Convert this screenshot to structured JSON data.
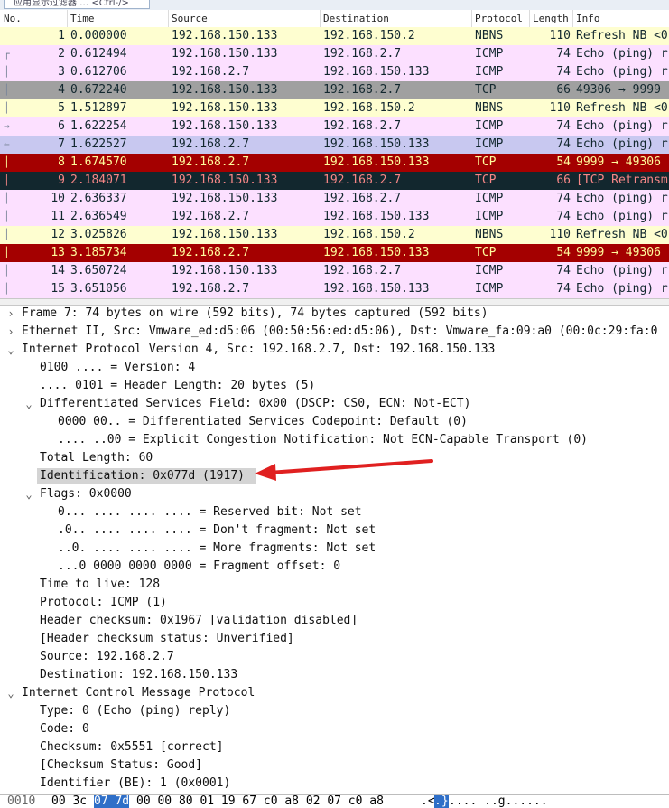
{
  "filter": {
    "text": "应用显示过滤器 … <Ctrl-/>"
  },
  "columns": [
    "No.",
    "Time",
    "Source",
    "Destination",
    "Protocol",
    "Length",
    "Info"
  ],
  "packets": [
    {
      "no": "1",
      "time": "0.000000",
      "src": "192.168.150.133",
      "dst": "192.168.150.2",
      "proto": "NBNS",
      "len": "110",
      "info": "Refresh NB <0",
      "bg": "#fefed0",
      "fg": "#12272e",
      "rel": ""
    },
    {
      "no": "2",
      "time": "0.612494",
      "src": "192.168.150.133",
      "dst": "192.168.2.7",
      "proto": "ICMP",
      "len": "74",
      "info": "Echo (ping) r",
      "bg": "#fce0ff",
      "fg": "#12272e",
      "rel": "┌"
    },
    {
      "no": "3",
      "time": "0.612706",
      "src": "192.168.2.7",
      "dst": "192.168.150.133",
      "proto": "ICMP",
      "len": "74",
      "info": "Echo (ping) r",
      "bg": "#fce0ff",
      "fg": "#12272e",
      "rel": "│"
    },
    {
      "no": "4",
      "time": "0.672240",
      "src": "192.168.150.133",
      "dst": "192.168.2.7",
      "proto": "TCP",
      "len": "66",
      "info": "49306 → 9999",
      "bg": "#a0a0a0",
      "fg": "#12272e",
      "rel": "│"
    },
    {
      "no": "5",
      "time": "1.512897",
      "src": "192.168.150.133",
      "dst": "192.168.150.2",
      "proto": "NBNS",
      "len": "110",
      "info": "Refresh NB <0",
      "bg": "#fefed0",
      "fg": "#12272e",
      "rel": "│"
    },
    {
      "no": "6",
      "time": "1.622254",
      "src": "192.168.150.133",
      "dst": "192.168.2.7",
      "proto": "ICMP",
      "len": "74",
      "info": "Echo (ping) r",
      "bg": "#fce0ff",
      "fg": "#12272e",
      "rel": "→"
    },
    {
      "no": "7",
      "time": "1.622527",
      "src": "192.168.2.7",
      "dst": "192.168.150.133",
      "proto": "ICMP",
      "len": "74",
      "info": "Echo (ping) r",
      "bg": "#c8c8f0",
      "fg": "#12272e",
      "rel": "←"
    },
    {
      "no": "8",
      "time": "1.674570",
      "src": "192.168.2.7",
      "dst": "192.168.150.133",
      "proto": "TCP",
      "len": "54",
      "info": "9999 → 49306",
      "bg": "#a40000",
      "fg": "#fffc9c",
      "rel": "│"
    },
    {
      "no": "9",
      "time": "2.184071",
      "src": "192.168.150.133",
      "dst": "192.168.2.7",
      "proto": "TCP",
      "len": "66",
      "info": "[TCP Retransm",
      "bg": "#12272e",
      "fg": "#f78787",
      "rel": "│"
    },
    {
      "no": "10",
      "time": "2.636337",
      "src": "192.168.150.133",
      "dst": "192.168.2.7",
      "proto": "ICMP",
      "len": "74",
      "info": "Echo (ping) r",
      "bg": "#fce0ff",
      "fg": "#12272e",
      "rel": "│"
    },
    {
      "no": "11",
      "time": "2.636549",
      "src": "192.168.2.7",
      "dst": "192.168.150.133",
      "proto": "ICMP",
      "len": "74",
      "info": "Echo (ping) r",
      "bg": "#fce0ff",
      "fg": "#12272e",
      "rel": "│"
    },
    {
      "no": "12",
      "time": "3.025826",
      "src": "192.168.150.133",
      "dst": "192.168.150.2",
      "proto": "NBNS",
      "len": "110",
      "info": "Refresh NB <0",
      "bg": "#fefed0",
      "fg": "#12272e",
      "rel": "│"
    },
    {
      "no": "13",
      "time": "3.185734",
      "src": "192.168.2.7",
      "dst": "192.168.150.133",
      "proto": "TCP",
      "len": "54",
      "info": "9999 → 49306",
      "bg": "#a40000",
      "fg": "#fffc9c",
      "rel": "│"
    },
    {
      "no": "14",
      "time": "3.650724",
      "src": "192.168.150.133",
      "dst": "192.168.2.7",
      "proto": "ICMP",
      "len": "74",
      "info": "Echo (ping) r",
      "bg": "#fce0ff",
      "fg": "#12272e",
      "rel": "│"
    },
    {
      "no": "15",
      "time": "3.651056",
      "src": "192.168.2.7",
      "dst": "192.168.150.133",
      "proto": "ICMP",
      "len": "74",
      "info": "Echo (ping) r",
      "bg": "#fce0ff",
      "fg": "#12272e",
      "rel": "│"
    }
  ],
  "details": [
    {
      "indent": 0,
      "arrow": "›",
      "text": "Frame 7: 74 bytes on wire (592 bits), 74 bytes captured (592 bits)"
    },
    {
      "indent": 0,
      "arrow": "›",
      "text": "Ethernet II, Src: Vmware_ed:d5:06 (00:50:56:ed:d5:06), Dst: Vmware_fa:09:a0 (00:0c:29:fa:0"
    },
    {
      "indent": 0,
      "arrow": "⌄",
      "text": "Internet Protocol Version 4, Src: 192.168.2.7, Dst: 192.168.150.133"
    },
    {
      "indent": 1,
      "arrow": "",
      "text": "0100 .... = Version: 4"
    },
    {
      "indent": 1,
      "arrow": "",
      "text": ".... 0101 = Header Length: 20 bytes (5)"
    },
    {
      "indent": 1,
      "arrow": "⌄",
      "text": "Differentiated Services Field: 0x00 (DSCP: CS0, ECN: Not-ECT)"
    },
    {
      "indent": 2,
      "arrow": "",
      "text": "0000 00.. = Differentiated Services Codepoint: Default (0)"
    },
    {
      "indent": 2,
      "arrow": "",
      "text": ".... ..00 = Explicit Congestion Notification: Not ECN-Capable Transport (0)"
    },
    {
      "indent": 1,
      "arrow": "",
      "text": "Total Length: 60"
    },
    {
      "indent": 1,
      "arrow": "",
      "text": "Identification: 0x077d (1917)",
      "highlight": true
    },
    {
      "indent": 1,
      "arrow": "⌄",
      "text": "Flags: 0x0000"
    },
    {
      "indent": 2,
      "arrow": "",
      "text": "0... .... .... .... = Reserved bit: Not set"
    },
    {
      "indent": 2,
      "arrow": "",
      "text": ".0.. .... .... .... = Don't fragment: Not set"
    },
    {
      "indent": 2,
      "arrow": "",
      "text": "..0. .... .... .... = More fragments: Not set"
    },
    {
      "indent": 2,
      "arrow": "",
      "text": "...0 0000 0000 0000 = Fragment offset: 0"
    },
    {
      "indent": 1,
      "arrow": "",
      "text": "Time to live: 128"
    },
    {
      "indent": 1,
      "arrow": "",
      "text": "Protocol: ICMP (1)"
    },
    {
      "indent": 1,
      "arrow": "",
      "text": "Header checksum: 0x1967 [validation disabled]"
    },
    {
      "indent": 1,
      "arrow": "",
      "text": "[Header checksum status: Unverified]"
    },
    {
      "indent": 1,
      "arrow": "",
      "text": "Source: 192.168.2.7"
    },
    {
      "indent": 1,
      "arrow": "",
      "text": "Destination: 192.168.150.133"
    },
    {
      "indent": 0,
      "arrow": "⌄",
      "text": "Internet Control Message Protocol"
    },
    {
      "indent": 1,
      "arrow": "",
      "text": "Type: 0 (Echo (ping) reply)"
    },
    {
      "indent": 1,
      "arrow": "",
      "text": "Code: 0"
    },
    {
      "indent": 1,
      "arrow": "",
      "text": "Checksum: 0x5551 [correct]"
    },
    {
      "indent": 1,
      "arrow": "",
      "text": "[Checksum Status: Good]"
    },
    {
      "indent": 1,
      "arrow": "",
      "text": "Identifier (BE): 1 (0x0001)"
    }
  ],
  "bytes": {
    "offset": "0010",
    "hex_before": "00 3c",
    "hex_selected": "07 7d",
    "hex_after": "00 00 80 01  19 67 c0 a8 02 07 c0 a8",
    "ascii_before": ".<",
    "ascii_selected": ".}",
    "ascii_after": ".... ..g......"
  },
  "annotation": {
    "arrow_color": "#e02020"
  }
}
